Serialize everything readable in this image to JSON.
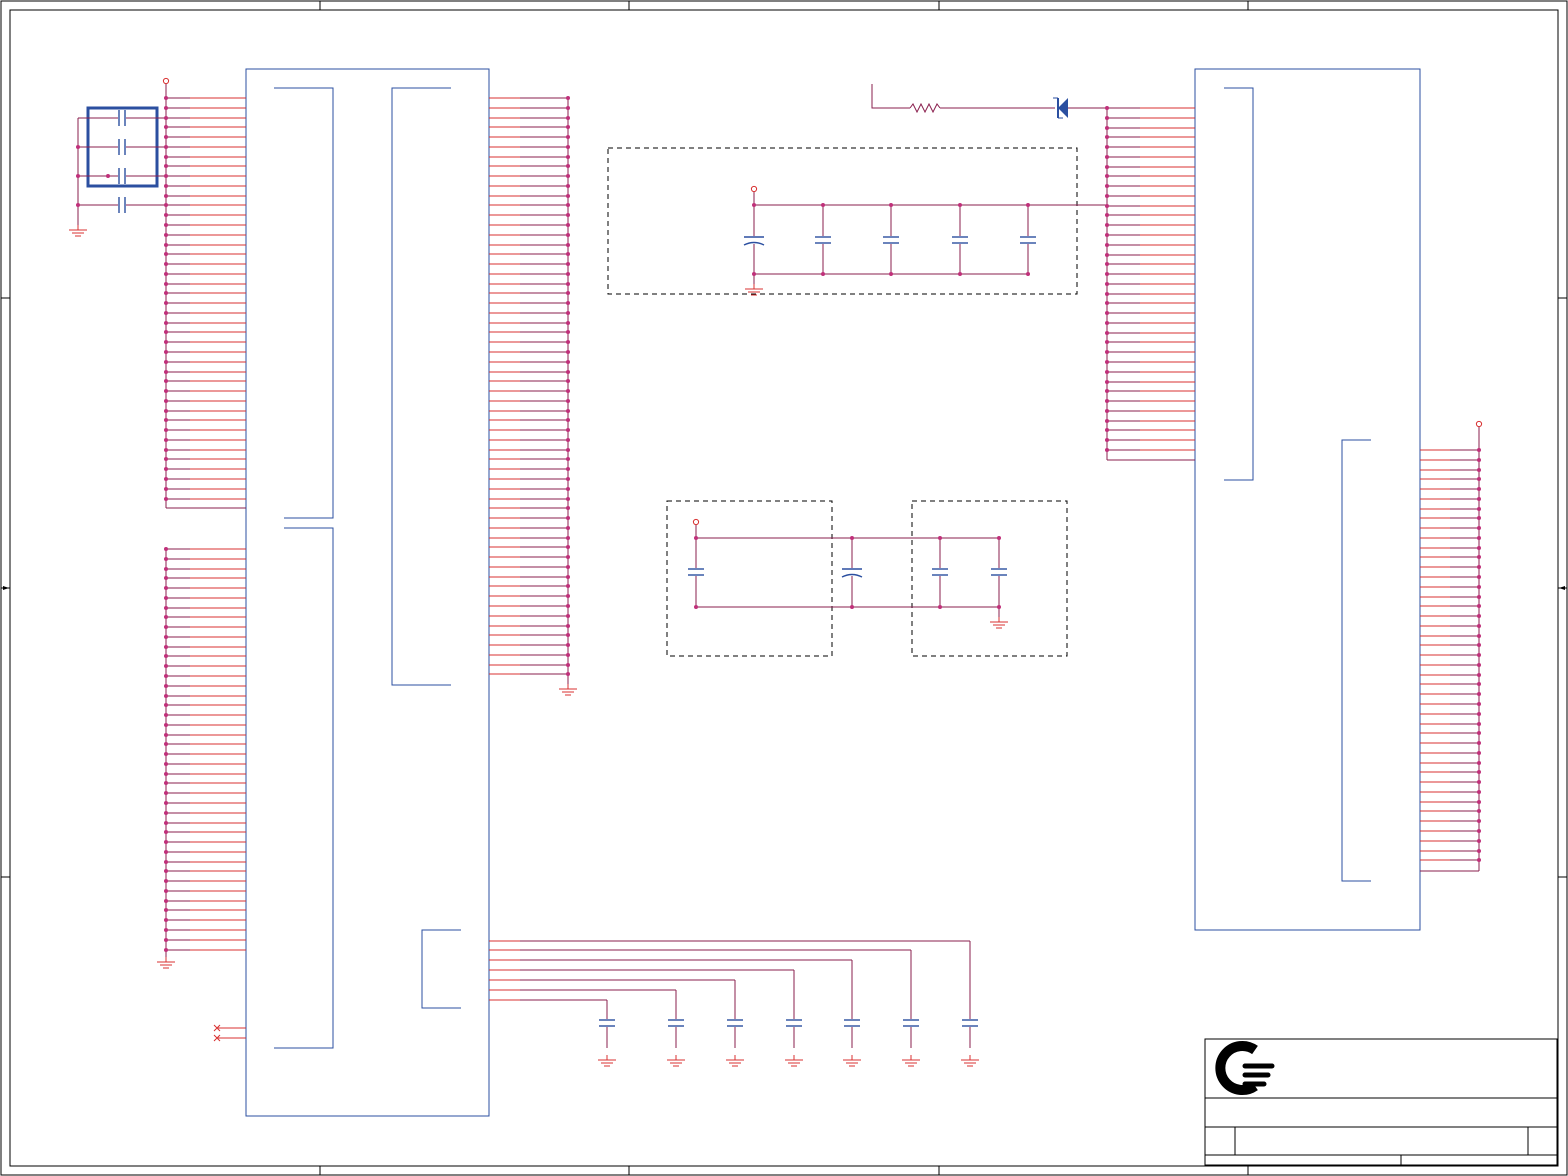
{
  "schematic": {
    "title_block": {
      "logo": "company-logo"
    },
    "colors": {
      "pin_wire": "#d83030",
      "net_wire": "#8a1f4e",
      "part_outline": "#2b4fa0",
      "junction": "#c0307a"
    },
    "icons": [
      "capacitor-icon",
      "resistor-icon",
      "diode-icon",
      "ground-icon",
      "power-port-icon",
      "no-connect-icon"
    ]
  }
}
